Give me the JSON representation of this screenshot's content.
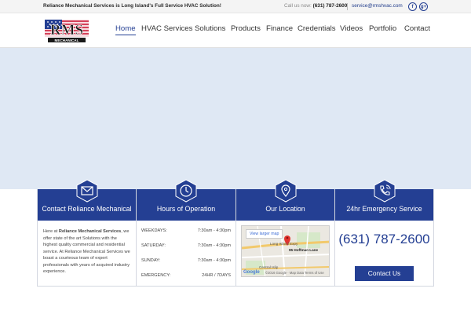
{
  "topbar": {
    "tagline": "Reliance Mechanical Services is Long Island's Full Service HVAC Solution!",
    "call_prefix": "Call us now:",
    "phone": "(631) 787-2600",
    "email": "service@rmshvac.com",
    "social": [
      {
        "icon": "facebook-icon",
        "glyph": "f"
      },
      {
        "icon": "google-plus-icon",
        "glyph": "g+"
      }
    ]
  },
  "logo": {
    "text": "RMS",
    "subtext": "MECHANICAL"
  },
  "nav": {
    "items": [
      {
        "label": "Home",
        "active": true
      },
      {
        "label": "HVAC Services"
      },
      {
        "label": "Solutions"
      },
      {
        "label": "Products"
      },
      {
        "label": "Finance"
      },
      {
        "label": "Credentials"
      },
      {
        "label": "Videos"
      },
      {
        "label": "Portfolio"
      },
      {
        "label": "Contact"
      }
    ]
  },
  "columns": {
    "contact": {
      "title": "Contact Reliance Mechanical",
      "icon": "envelope-icon",
      "about_prefix": "Here at ",
      "about_bold": "Reliance Mechanical Services",
      "about_rest": ", we offer state of the art Solutions with the highest quality commercial and residential service. At Reliance Mechanical Services we boast a courteous team of expert professionals with years of acquired industry experience."
    },
    "hours": {
      "title": "Hours of Operation",
      "icon": "clock-icon",
      "rows": [
        {
          "day": "WEEKDAYS:",
          "time": "7:30am - 4:30pm"
        },
        {
          "day": "SATURDAY:",
          "time": "7:30am - 4:30pm"
        },
        {
          "day": "SUNDAY:",
          "time": "7:30am - 4:30pm"
        },
        {
          "day": "EMERGENCY:",
          "time": "24HR / 7DAYS"
        }
      ]
    },
    "location": {
      "title": "Our Location",
      "icon": "map-pin-icon",
      "view_map": "View larger map",
      "pin_label": "95 Hoffman Lane",
      "road_label": "Long Island Expy",
      "area_label": "Central Islip",
      "map_footer": "©2016 Google · Map Data   Terms of Use",
      "brand": "Google"
    },
    "emergency": {
      "title": "24hr Emergency Service",
      "icon": "phone-icon",
      "phone": "(631) 787-2600",
      "button": "Contact Us"
    }
  },
  "colors": {
    "brand": "#243f93",
    "hero": "#dfe8f4"
  }
}
